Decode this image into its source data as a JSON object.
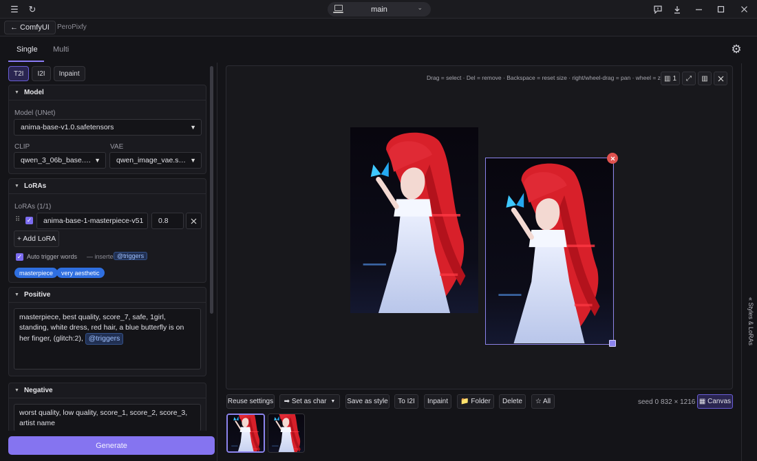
{
  "titlebar": {
    "branch": "main"
  },
  "appbar": {
    "back_label": "← ComfyUI",
    "subtitle": "PeroPixfy"
  },
  "mode_tabs": [
    {
      "label": "Single",
      "active": true
    },
    {
      "label": "Multi",
      "active": false
    }
  ],
  "sub_tabs": [
    {
      "label": "T2I",
      "active": true
    },
    {
      "label": "I2I",
      "active": false
    },
    {
      "label": "Inpaint",
      "active": false
    }
  ],
  "model": {
    "title": "Model",
    "unet_label": "Model (UNet)",
    "unet_value": "anima-base-v1.0.safetensors",
    "clip_label": "CLIP",
    "clip_value": "qwen_3_06b_base.safetensors",
    "vae_label": "VAE",
    "vae_value": "qwen_image_vae.safetensors"
  },
  "loras": {
    "title": "LoRAs",
    "count_label": "LoRAs (1/1)",
    "items": [
      {
        "name": "anima-base-1-masterpiece-v51",
        "strength": "0.8",
        "enabled": true
      }
    ],
    "add_label": "+ Add LoRA",
    "auto_trigger_label": "Auto trigger words",
    "inserted_label": "— inserted at",
    "inserted_tag": "@triggers",
    "trigger_words": [
      "masterpiece",
      "very aesthetic"
    ]
  },
  "positive": {
    "title": "Positive",
    "text": "masterpiece, best quality, score_7, safe, 1girl, standing, white dress, red hair, a blue butterfly is on her finger, (glitch:2),",
    "tag": "@triggers"
  },
  "negative": {
    "title": "Negative",
    "text": "worst quality, low quality, score_1, score_2, score_3, artist name"
  },
  "generate_label": "Generate",
  "canvas": {
    "hint": "Drag = select · Del = remove · Backspace = reset size · right/wheel-drag = pan · wheel = zoom",
    "count_label": "1"
  },
  "toolbar": {
    "reuse": "Reuse settings",
    "set_as_char": "➡ Set as char",
    "save_style": "Save as style",
    "to_i2i": "To I2I",
    "inpaint": "Inpaint",
    "folder": "📁 Folder",
    "delete": "Delete",
    "all": "☆ All",
    "seed": "seed 0",
    "size": "832 × 1216",
    "canvas": "▦ Canvas"
  },
  "right_tab": "« Styles & LoRAs",
  "colors": {
    "accent": "#8574f0",
    "pill": "#2f6fe0",
    "danger": "#e0524f"
  }
}
